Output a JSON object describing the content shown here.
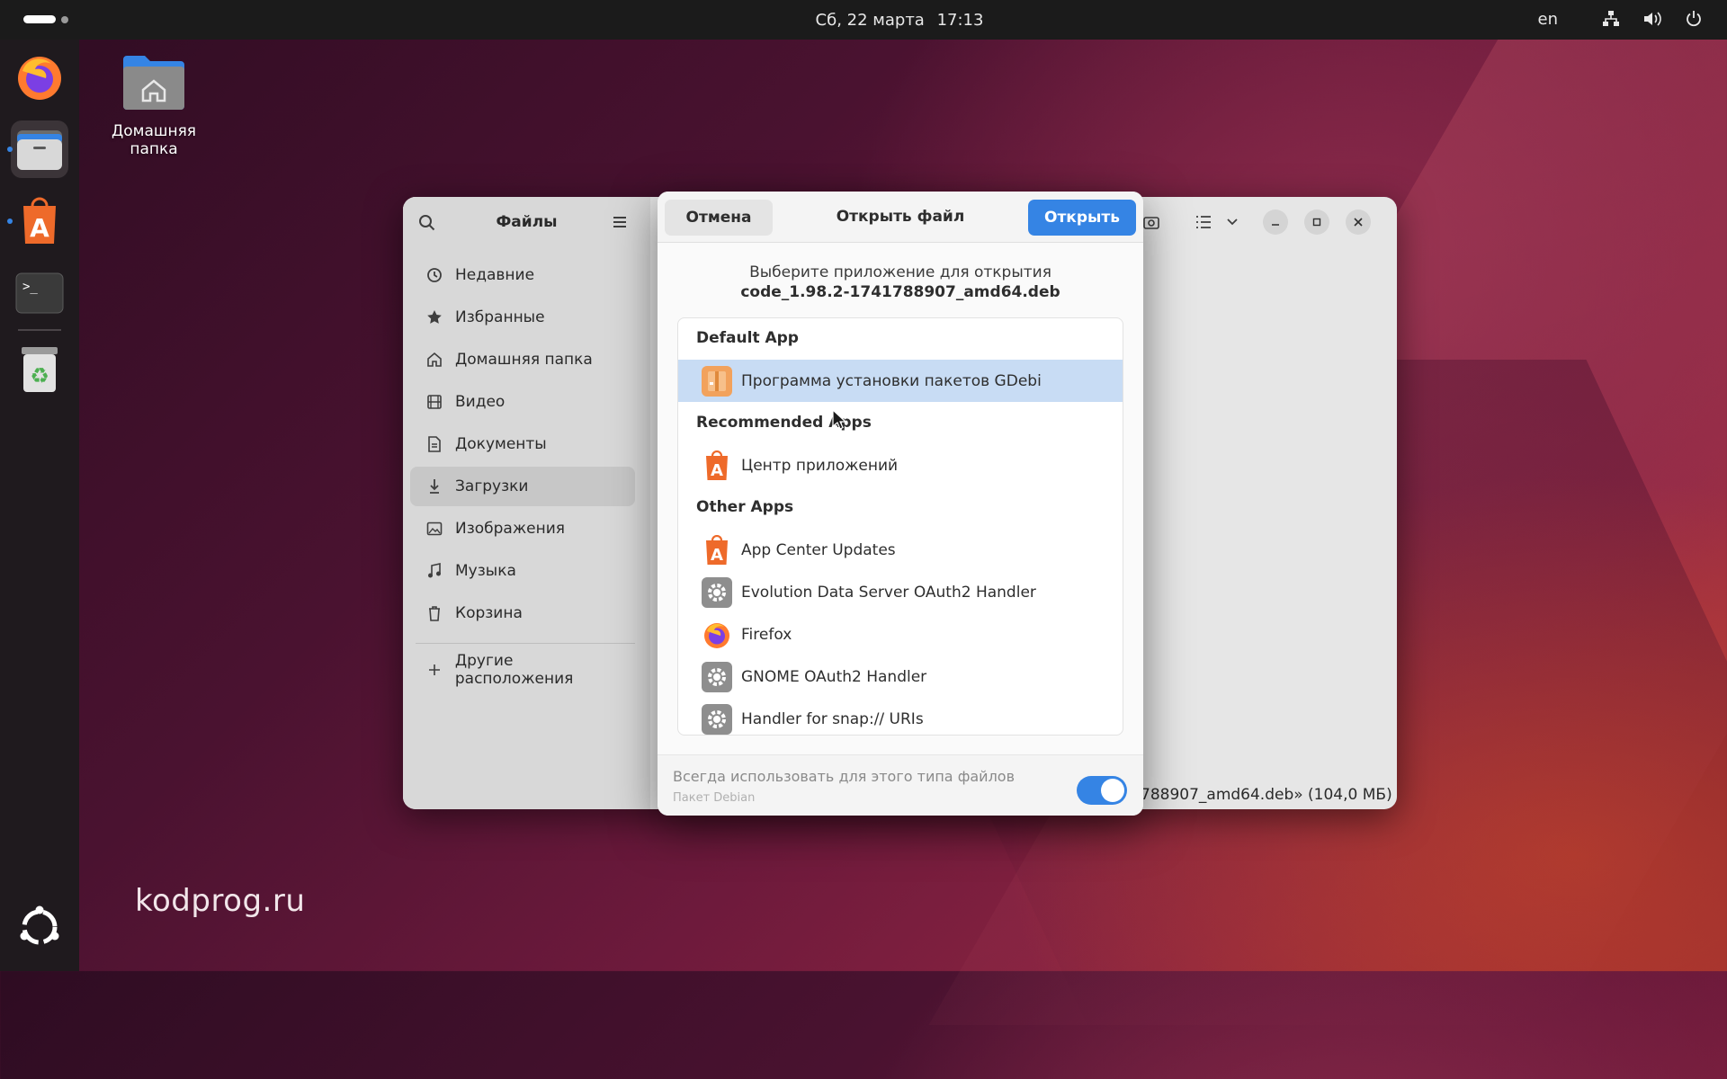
{
  "topbar": {
    "date": "Сб, 22 марта",
    "time": "17:13",
    "lang": "en",
    "icons": [
      "network-icon",
      "volume-icon",
      "power-icon"
    ]
  },
  "dock": {
    "items": [
      {
        "name": "firefox-icon",
        "running": false
      },
      {
        "name": "files-icon",
        "running": true
      },
      {
        "name": "app-center-icon",
        "running": true
      },
      {
        "name": "terminal-icon",
        "running": false
      },
      {
        "name": "trash-icon",
        "running": false
      },
      {
        "name": "ubuntu-apps-grid-icon",
        "running": false
      }
    ]
  },
  "desktop": {
    "home_label": "Домашняя папка",
    "watermark": "kodprog.ru"
  },
  "files_window": {
    "title": "Файлы",
    "sidebar": [
      {
        "label": "Недавние",
        "icon": "clock-icon"
      },
      {
        "label": "Избранные",
        "icon": "star-icon"
      },
      {
        "label": "Домашняя папка",
        "icon": "home-icon"
      },
      {
        "label": "Видео",
        "icon": "film-icon"
      },
      {
        "label": "Документы",
        "icon": "document-icon"
      },
      {
        "label": "Загрузки",
        "icon": "download-icon",
        "selected": true
      },
      {
        "label": "Изображения",
        "icon": "image-icon"
      },
      {
        "label": "Музыка",
        "icon": "music-icon"
      },
      {
        "label": "Корзина",
        "icon": "trash-icon"
      }
    ],
    "other_locations": "Другие расположения",
    "status": "788907_amd64.deb»  (104,0 МБ)"
  },
  "dialog": {
    "cancel_label": "Отмена",
    "title": "Открыть файл",
    "open_label": "Открыть",
    "prompt": "Выберите приложение для открытия",
    "filename": "code_1.98.2-1741788907_amd64.deb",
    "groups": {
      "default": "Default App",
      "recommended": "Recommended Apps",
      "other": "Other Apps"
    },
    "default_apps": [
      {
        "label": "Программа установки пакетов GDebi",
        "icon": "gdebi-icon",
        "selected": true
      }
    ],
    "recommended_apps": [
      {
        "label": "Центр приложений",
        "icon": "app-center-icon"
      }
    ],
    "other_apps": [
      {
        "label": "App Center Updates",
        "icon": "app-center-icon"
      },
      {
        "label": "Evolution Data Server OAuth2 Handler",
        "icon": "gear-icon"
      },
      {
        "label": "Firefox",
        "icon": "firefox-icon"
      },
      {
        "label": "GNOME OAuth2 Handler",
        "icon": "gear-icon"
      },
      {
        "label": "Handler for snap:// URIs",
        "icon": "gear-icon"
      }
    ],
    "always_use_label": "Всегда использовать для этого типа файлов",
    "file_type_label": "Пакет Debian",
    "always_use_on": true
  },
  "colors": {
    "accent": "#3584e4",
    "selection": "#c8dcf4",
    "dock_bg": "#1f1a1e",
    "topbar_bg": "#1b1b1b"
  }
}
